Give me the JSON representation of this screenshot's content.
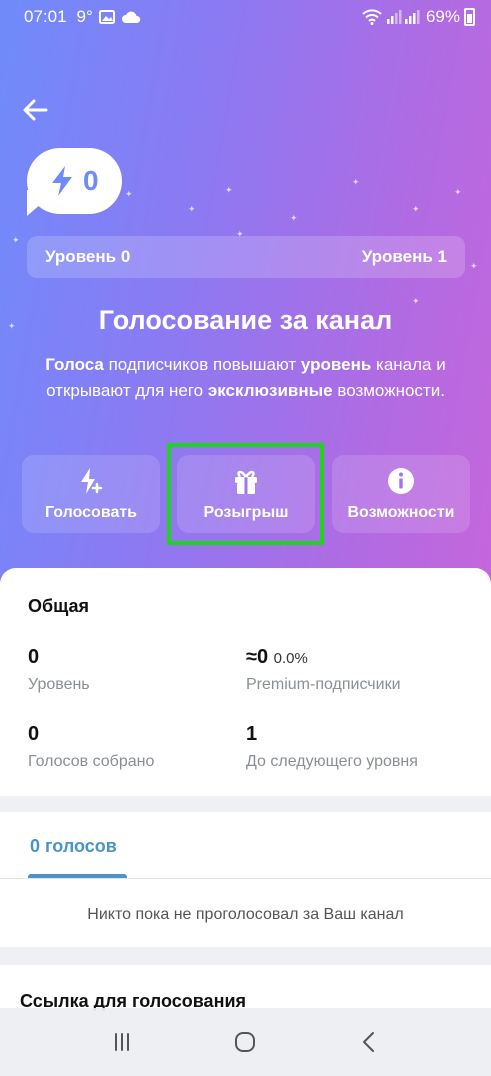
{
  "status_bar": {
    "time": "07:01",
    "temperature": "9°",
    "battery": "69%",
    "icons": [
      "image-icon",
      "cloud-icon",
      "wifi-icon",
      "signal-icon",
      "signal-icon",
      "battery-icon"
    ]
  },
  "header": {
    "back_icon": "arrow-left-icon",
    "boost_count": "0",
    "boost_icon": "lightning-icon",
    "level_current": "Уровень 0",
    "level_next": "Уровень 1",
    "progress": 0.0
  },
  "boost": {
    "title": "Голосование за канал",
    "desc_bold_1": "Голоса",
    "desc_text_1": " подписчиков повышают ",
    "desc_bold_2": "уровень",
    "desc_text_2": " канала и открывают для него ",
    "desc_bold_3": "эксклюзивные",
    "desc_text_3": " возможности."
  },
  "actions": [
    {
      "label": "Голосовать",
      "icon": "boost-icon"
    },
    {
      "label": "Розыгрыш",
      "icon": "gift-icon"
    },
    {
      "label": "Возможности",
      "icon": "info-icon"
    }
  ],
  "overview": {
    "title": "Общая",
    "stats": [
      {
        "value": "0",
        "label": "Уровень"
      },
      {
        "value": "≈0",
        "extra": "0.0%",
        "label": "Premium-подписчики"
      },
      {
        "value": "0",
        "label": "Голосов собрано"
      },
      {
        "value": "1",
        "label": "До следующего уровня"
      }
    ]
  },
  "boosts_list": {
    "tab_label": "0 голосов",
    "empty_message": "Никто пока не проголосовал за Ваш канал"
  },
  "link_section": {
    "title": "Ссылка для голосования"
  },
  "colors": {
    "gradient_start": "#6f8bfb",
    "gradient_end": "#c566dc",
    "accent_blue": "#4a94c9",
    "highlight_green": "#1fd41f"
  },
  "nav": {
    "icons": [
      "recent-apps-icon",
      "home-icon",
      "back-icon"
    ]
  }
}
